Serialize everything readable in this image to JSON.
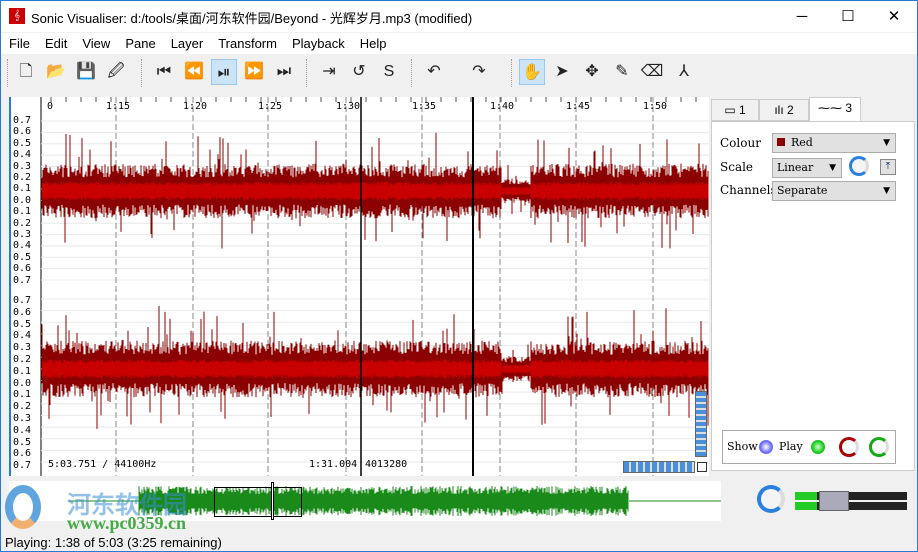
{
  "window": {
    "title": "Sonic Visualiser: d:/tools/桌面/河东软件园/Beyond - 光辉岁月.mp3 (modified)",
    "minimize": "─",
    "maximize": "☐",
    "close": "✕"
  },
  "menu": [
    "File",
    "Edit",
    "View",
    "Pane",
    "Layer",
    "Transform",
    "Playback",
    "Help"
  ],
  "toolbar": {
    "icons": [
      "new-icon",
      "open-icon",
      "save-icon",
      "save-as-icon",
      "rewind-start-icon",
      "rewind-icon",
      "play-pause-icon",
      "fast-forward-icon",
      "fast-forward-end-icon",
      "play-selection-icon",
      "loop-icon",
      "solo-icon",
      "undo-icon",
      "redo-icon",
      "navigate-icon",
      "select-icon",
      "move-icon",
      "draw-icon",
      "erase-icon",
      "measure-icon"
    ],
    "glyphs": [
      "🗋",
      "📂",
      "💾",
      "🖉",
      "⏮",
      "⏪",
      "⏯",
      "⏩",
      "⏭",
      "⇥",
      "↺",
      "S",
      "↶",
      "↷",
      "✋",
      "➤",
      "✥",
      "✎",
      "⌫",
      "⅄"
    ]
  },
  "ruler": [
    "0",
    "1:15",
    "1:20",
    "1:25",
    "1:30",
    "1:35",
    "1:40",
    "1:45",
    "1:50"
  ],
  "yaxis": [
    "0.7",
    "0.6",
    "0.5",
    "0.4",
    "0.3",
    "0.2",
    "0.1",
    "0.0",
    "0.1",
    "0.2",
    "0.3",
    "0.4",
    "0.5",
    "0.6",
    "0.7"
  ],
  "pane": {
    "duration_info": "5:03.751 / 44100Hz",
    "cursor_info": "1:31.004",
    "frame_info": "4013280"
  },
  "colors": {
    "wave_outer": "#8b0000",
    "wave_inner": "#c80000",
    "overview": "#1a8a1a"
  },
  "properties": {
    "tabs": [
      "1",
      "2",
      "3"
    ],
    "colour_label": "Colour",
    "colour_value": "Red",
    "scale_label": "Scale",
    "scale_value": "Linear",
    "channels_label": "Channels",
    "channels_value": "Separate",
    "show_label": "Show",
    "play_label": "Play"
  },
  "watermark": {
    "text1": "河东软件园",
    "text2": "www.pc0359.cn"
  },
  "status": "Playing: 1:38 of 5:03 (3:25 remaining)",
  "playback_position_fraction": 0.323
}
